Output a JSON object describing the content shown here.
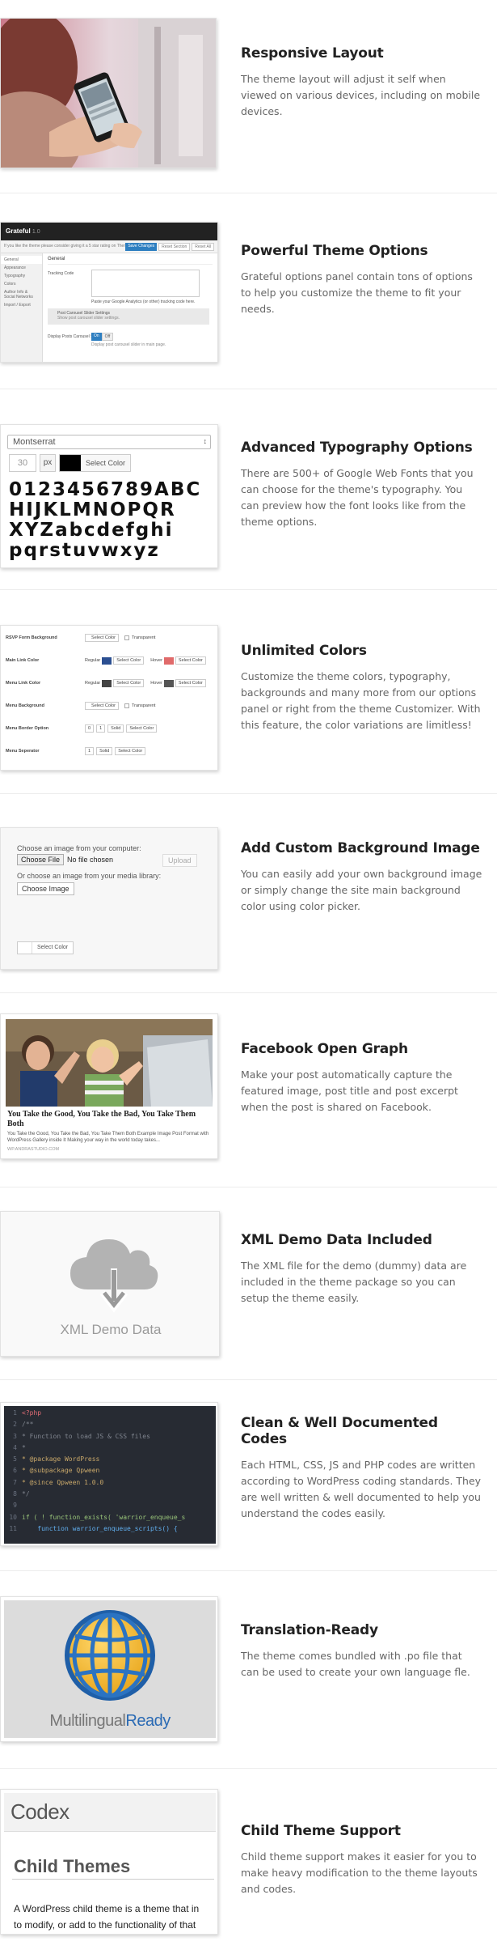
{
  "features": [
    {
      "title": "Responsive Layout",
      "desc": "The theme layout will adjust it self when viewed on various devices, including on mobile devices."
    },
    {
      "title": "Powerful Theme Options",
      "desc": "Grateful options panel contain tons of options to help you customize the theme to fit your needs."
    },
    {
      "title": "Advanced Typography Options",
      "desc": "There are 500+ of Google Web Fonts that you can choose for the theme's typography. You can preview how the font looks like from the theme options."
    },
    {
      "title": "Unlimited Colors",
      "desc": "Customize the theme colors, typography, backgrounds and many more from our options panel or right from the theme Customizer. With this feature, the color variations are limitless!"
    },
    {
      "title": "Add Custom Background Image",
      "desc": "You can easily add your own background image or simply change the site main background color using color picker."
    },
    {
      "title": "Facebook Open Graph",
      "desc": "Make your post automatically capture the featured image, post title and post excerpt when the post is shared on Facebook."
    },
    {
      "title": "XML Demo Data Included",
      "desc": "The XML file for the demo (dummy) data are included in the theme package so you can setup the theme easily."
    },
    {
      "title": "Clean & Well Documented Codes",
      "desc": "Each HTML, CSS, JS and PHP codes are written according to WordPress coding standards. They are well written & well documented to help you understand the codes easily."
    },
    {
      "title": "Translation-Ready",
      "desc": "The theme comes bundled with .po file that can be used to create your own language fle."
    },
    {
      "title": "Child Theme Support",
      "desc": "Child theme support makes it easier for you to make heavy modification to the theme layouts and codes."
    }
  ],
  "theme_options": {
    "brand": "Grateful",
    "version": "1.0",
    "intro": "If you like the theme please consider giving it a 5 star rating on ThemeForest",
    "save_btn": "Save Changes",
    "reset_btn": "Reset Section",
    "reset_all_btn": "Reset All",
    "menu": [
      "General",
      "Appearance",
      "Typography",
      "Colors",
      "Author Info & Social Networks",
      "Import / Export"
    ],
    "section": "General",
    "field_label": "Tracking Code",
    "field_help": "Paste your Google Analytics (or other) tracking code here.",
    "notice_title": "Post Carousel Slider Settings",
    "notice_body": "Show post carousel slider settings.",
    "toggle_label": "Display Posts Carousel Slider",
    "toggle_on": "On",
    "toggle_off": "Off",
    "toggle_help": "Display post carousel slider in main page."
  },
  "typography": {
    "font": "Montserrat",
    "size": "30",
    "unit": "px",
    "color_btn": "Select Color",
    "sample_lines": [
      "0123456789ABC",
      "HIJKLMNOPQR",
      "XYZabcdefghi",
      "pqrstuvwxyz"
    ]
  },
  "colors": {
    "rows": [
      {
        "label": "RSVP Form Background",
        "btn": "Select Color",
        "extra": "Transparent"
      },
      {
        "label": "Main Link Color",
        "regular": "Regular",
        "btn": "Select Color",
        "hover": "Hover",
        "btn2": "Select Color"
      },
      {
        "label": "Menu Link Color",
        "regular": "Regular",
        "btn": "Select Color",
        "hover": "Hover",
        "btn2": "Select Color"
      },
      {
        "label": "Menu Background",
        "btn": "Select Color",
        "extra": "Transparent"
      },
      {
        "label": "Menu Border Option",
        "v1": "0",
        "v2": "1",
        "style": "Solid",
        "btn": "Select Color"
      },
      {
        "label": "Menu Seperator",
        "v1": "1",
        "style": "Solid",
        "btn": "Select Color"
      }
    ],
    "swatch_main": "#2b4f91",
    "swatch_hover": "#e06a6a",
    "swatch_menu": "#444444",
    "swatch_menu_hover": "#555555"
  },
  "background": {
    "label1": "Choose an image from your computer:",
    "choose_file": "Choose File",
    "no_file": "No file chosen",
    "upload": "Upload",
    "label2": "Or choose an image from your media library:",
    "choose_image": "Choose Image",
    "color_btn": "Select Color"
  },
  "facebook": {
    "title": "You Take the Good, You Take the Bad, You Take Them Both",
    "excerpt": "You Take the Good, You Take the Bad, You Take Them Both Example Image Post Format with WordPress Gallery inside It Making your way in the world today takes...",
    "domain": "WP.ANDRASTUDIO.COM"
  },
  "xml": {
    "label": "XML Demo Data"
  },
  "code": {
    "lines": [
      {
        "n": "1",
        "t": "<?php"
      },
      {
        "n": "2",
        "t": "/**"
      },
      {
        "n": "3",
        "t": " * Function to load JS & CSS files"
      },
      {
        "n": "4",
        "t": " *"
      },
      {
        "n": "5",
        "t": " * @package WordPress"
      },
      {
        "n": "6",
        "t": " * @subpackage Qpween"
      },
      {
        "n": "7",
        "t": " * @since Qpween 1.0.0"
      },
      {
        "n": "8",
        "t": " */"
      },
      {
        "n": "9",
        "t": ""
      },
      {
        "n": "10",
        "t": "if ( ! function_exists( 'warrior_enqueue_s"
      },
      {
        "n": "11",
        "t": "    function warrior_enqueue_scripts() {"
      }
    ]
  },
  "translation": {
    "word1": "Multilingual",
    "word2": "Ready"
  },
  "codex": {
    "brand": "Codex",
    "heading": "Child Themes",
    "line1": "A WordPress child theme is a theme that in",
    "line2": "to modify, or add to the functionality of that"
  }
}
